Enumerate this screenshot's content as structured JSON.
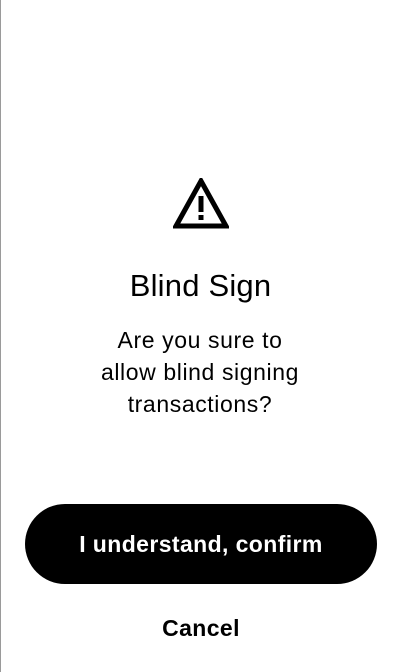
{
  "dialog": {
    "icon": "warning-icon",
    "title": "Blind Sign",
    "message_lines": [
      "Are you sure to",
      "allow blind signing",
      "transactions?"
    ],
    "confirm_label": "I understand, confirm",
    "cancel_label": "Cancel"
  },
  "colors": {
    "background": "#ffffff",
    "primary": "#000000",
    "on_primary": "#ffffff"
  }
}
